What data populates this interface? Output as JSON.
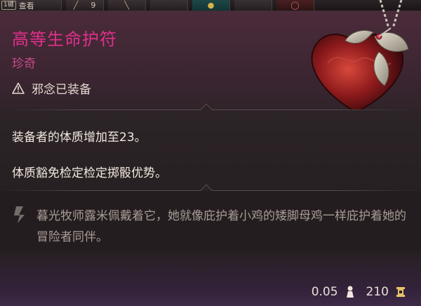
{
  "hotbar": {
    "first_key": "1键",
    "first_label": "查看",
    "count": "9"
  },
  "item": {
    "name": "高等生命护符",
    "rarity": "珍奇",
    "status": "邪念已装备",
    "effects": [
      "装备者的体质增加至23。",
      "体质豁免检定检定掷骰优势。"
    ],
    "flavor": "暮光牧师露米佩戴着它，她就像庇护着小鸡的矮脚母鸡一样庇护着她的冒险者同伴。",
    "weight": "0.05",
    "value": "210"
  },
  "colors": {
    "rarity_accent": "#e0308a",
    "rarity_sub": "#c94a8c"
  },
  "icons": {
    "status": "warning-triangle-icon",
    "flavor": "quote-icon",
    "weight": "weight-icon",
    "value": "gold-coin-icon",
    "art": "heart-amulet-icon"
  }
}
